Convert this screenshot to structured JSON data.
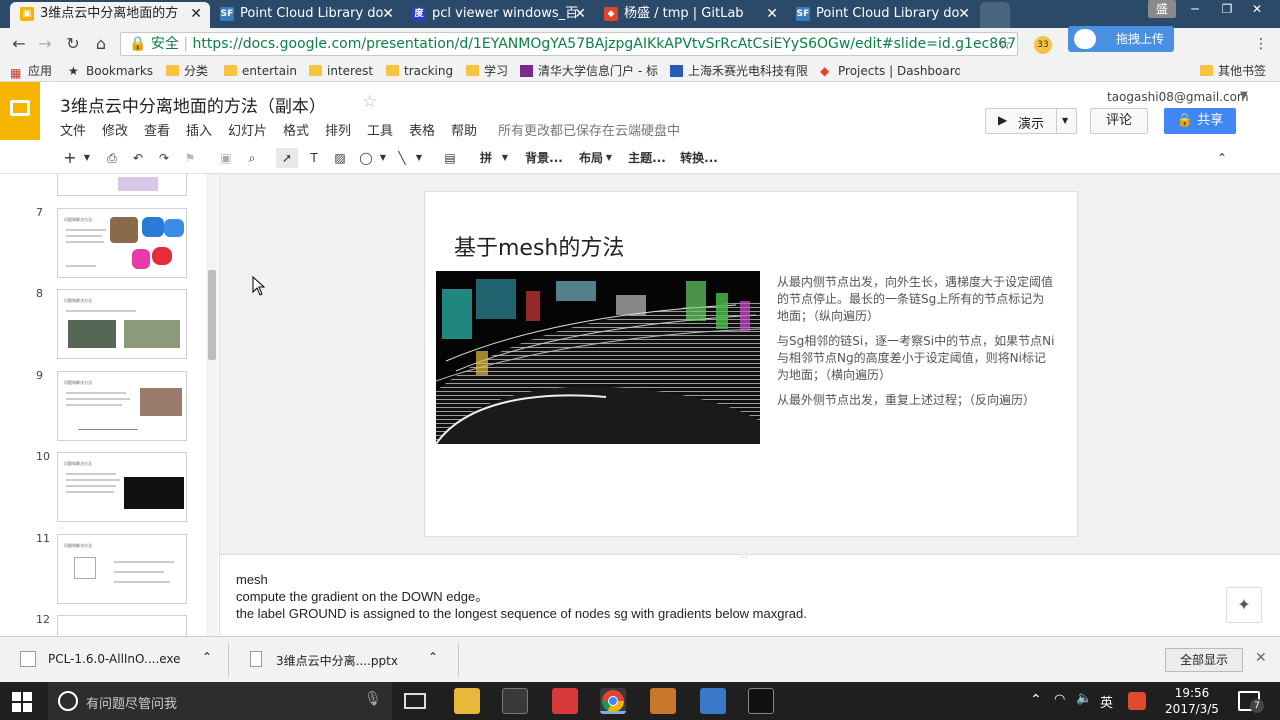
{
  "browser": {
    "tabs": [
      {
        "label": "3维点云中分离地面的方",
        "icon": "slides-icon",
        "active": true
      },
      {
        "label": "Point Cloud Library do",
        "icon": "sf-icon"
      },
      {
        "label": "pcl viewer windows_百",
        "icon": "baidu-icon"
      },
      {
        "label": "杨盛 / tmp | GitLab",
        "icon": "gitlab-icon"
      },
      {
        "label": "Point Cloud Library do",
        "icon": "sf-icon"
      }
    ],
    "window_user": "盛",
    "secure_label": "安全",
    "url": "https://docs.google.com/presentation/d/1EYANMOgYA57BAjzpgAIKkAPVtvSrRcAtCsiEYyS6OGw/edit#slide=id.g1ec867",
    "upload_label": "拖拽上传",
    "ext_badge": "33",
    "bookmarks": [
      {
        "label": "应用",
        "icon": "apps-icon"
      },
      {
        "label": "Bookmarks",
        "icon": "star-icon"
      },
      {
        "label": "分类",
        "icon": "folder-icon"
      },
      {
        "label": "entertain",
        "icon": "folder-icon"
      },
      {
        "label": "interest",
        "icon": "folder-icon"
      },
      {
        "label": "tracking",
        "icon": "folder-icon"
      },
      {
        "label": "学习",
        "icon": "folder-icon"
      },
      {
        "label": "清华大学信息门户 - 标",
        "icon": "tsinghua-icon"
      },
      {
        "label": "上海禾赛光电科技有限",
        "icon": "hesai-icon"
      },
      {
        "label": "Projects | Dashboard",
        "icon": "gitlab-icon"
      },
      {
        "label": "其他书签",
        "icon": "folder-icon"
      }
    ]
  },
  "docs": {
    "title": "3维点云中分离地面的方法（副本）",
    "account": "taogashi08@gmail.com",
    "menus": [
      "文件",
      "修改",
      "查看",
      "插入",
      "幻灯片",
      "格式",
      "排列",
      "工具",
      "表格",
      "帮助"
    ],
    "save_status": "所有更改都已保存在云端硬盘中",
    "present_label": "演示",
    "comment_label": "评论",
    "share_label": "共享",
    "toolbar": {
      "background": "背景...",
      "layout": "布局",
      "theme": "主题...",
      "transition": "转换...",
      "arrange": "拼"
    }
  },
  "filmstrip": {
    "slides": [
      {
        "num": "7",
        "heading": "问题和解决方法"
      },
      {
        "num": "8",
        "heading": "问题和解决方法"
      },
      {
        "num": "9",
        "heading": "问题和解决方法"
      },
      {
        "num": "10",
        "heading": "问题和解决方法"
      },
      {
        "num": "11",
        "heading": "问题和解决方法"
      },
      {
        "num": "12",
        "heading": ""
      }
    ]
  },
  "slide": {
    "title": "基于mesh的方法",
    "paragraphs": [
      "从最内侧节点出发，向外生长，遇梯度大于设定阈值的节点停止。最长的一条链Sg上所有的节点标记为地面；（纵向遍历）",
      "与Sg相邻的链Si，逐一考察Si中的节点，如果节点Ni与相邻节点Ng的高度差小于设定阈值，则将Ni标记为地面；（横向遍历）",
      "从最外侧节点出发，重复上述过程；（反向遍历）"
    ]
  },
  "notes": {
    "lines": [
      "mesh",
      "compute the gradient on the DOWN edge。",
      "the label GROUND is assigned to the longest sequence of nodes sg with gradients below maxgrad."
    ]
  },
  "downloads": {
    "items": [
      "PCL-1.6.0-AllInO....exe",
      "3维点云中分离....pptx"
    ],
    "show_all": "全部显示"
  },
  "taskbar": {
    "search_placeholder": "有问题尽管问我",
    "ime": "英",
    "time": "19:56",
    "date": "2017/3/5",
    "notification_count": "7"
  },
  "colors": {
    "accent_blue": "#4285f4",
    "slides_yellow": "#f4b400",
    "tabstrip": "#2b4a6a"
  }
}
